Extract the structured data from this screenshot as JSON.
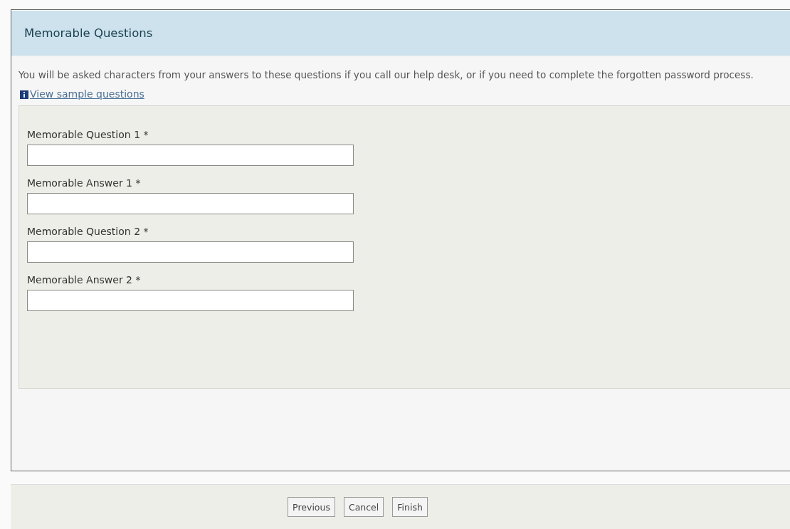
{
  "panel": {
    "title": "Memorable Questions",
    "intro": "You will be asked characters from your answers to these questions if you call our help desk, or if you need to complete the forgotten password process.",
    "link": "View sample questions"
  },
  "fields": [
    {
      "label": "Memorable Question 1 *"
    },
    {
      "label": "Memorable Answer 1 *"
    },
    {
      "label": "Memorable Question 2 *"
    },
    {
      "label": "Memorable Answer 2 *"
    }
  ],
  "buttons": [
    "Previous",
    "Cancel",
    "Finish"
  ]
}
